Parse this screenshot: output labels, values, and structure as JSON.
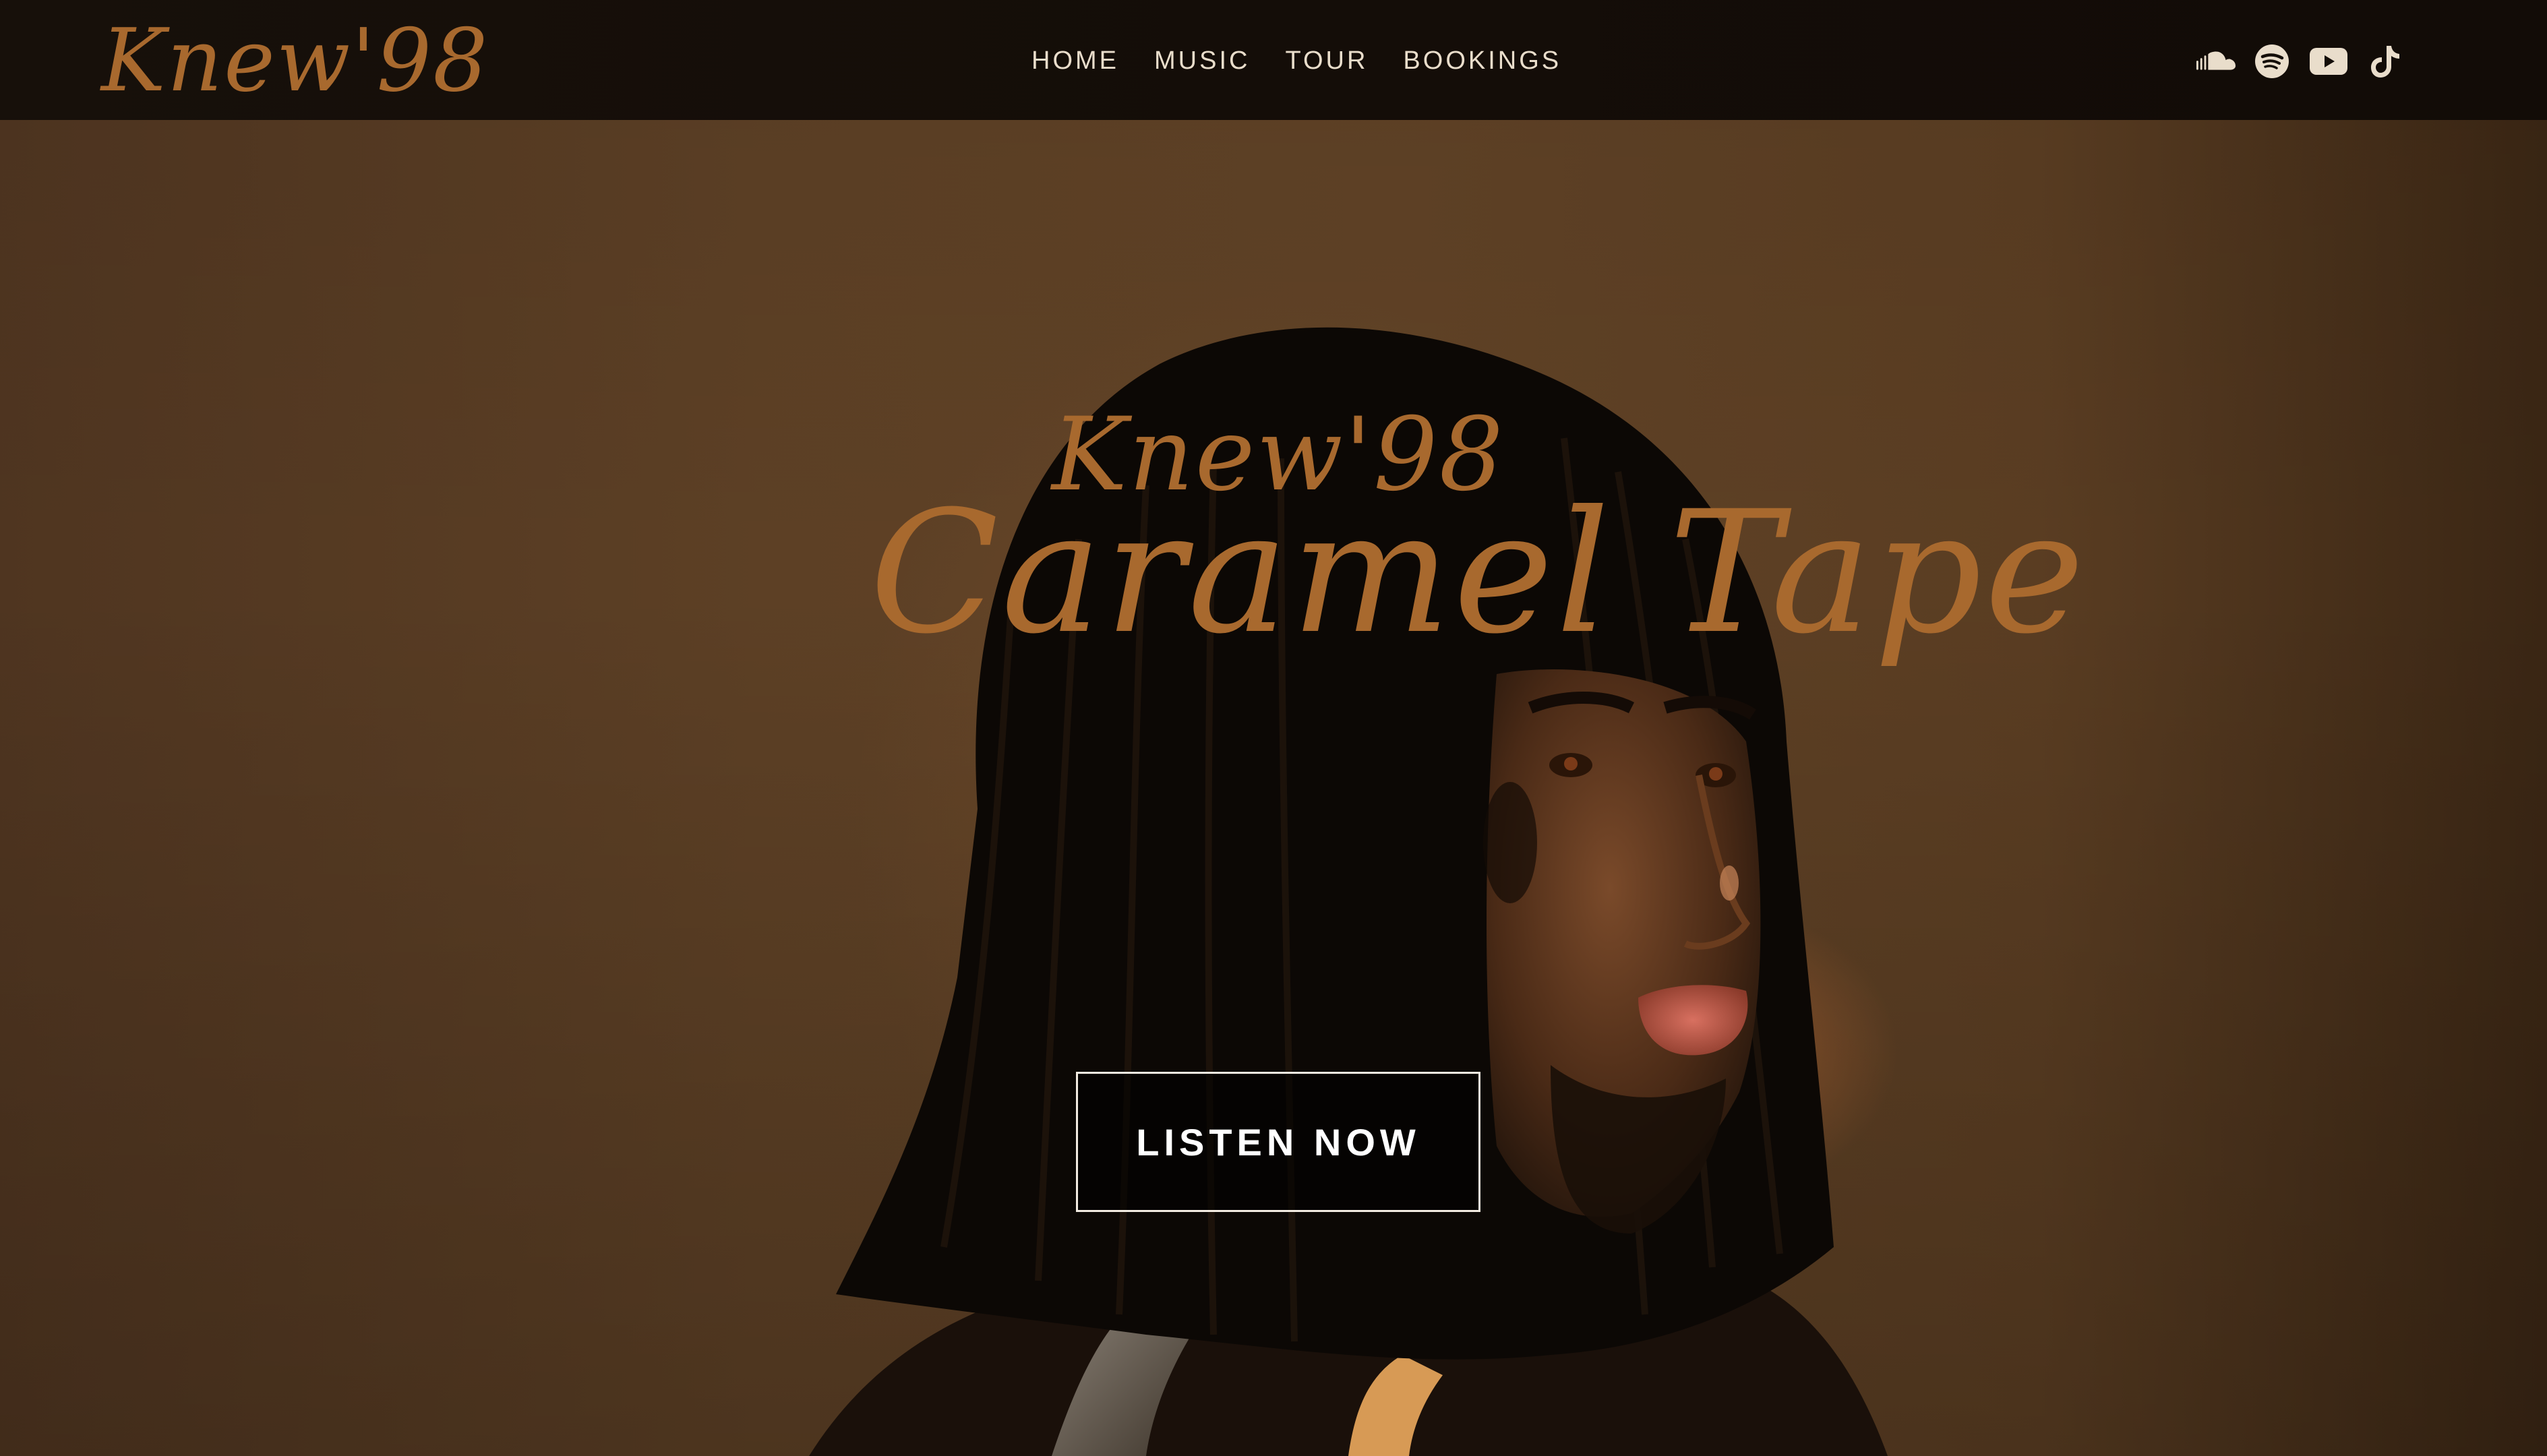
{
  "header": {
    "logo_text": "Knew'98",
    "nav": [
      {
        "label": "HOME"
      },
      {
        "label": "MUSIC"
      },
      {
        "label": "TOUR"
      },
      {
        "label": "BOOKINGS"
      }
    ],
    "social_icons": [
      "soundcloud-icon",
      "spotify-icon",
      "youtube-icon",
      "tiktok-icon"
    ]
  },
  "hero": {
    "artist": "Knew'98",
    "title": "Caramel Tape",
    "cta_label": "LISTEN NOW"
  },
  "colors": {
    "accent": "#a8692e",
    "header_bg": "#140d08",
    "nav_text": "#e9ddcb",
    "cta_border": "#f3ece2"
  }
}
